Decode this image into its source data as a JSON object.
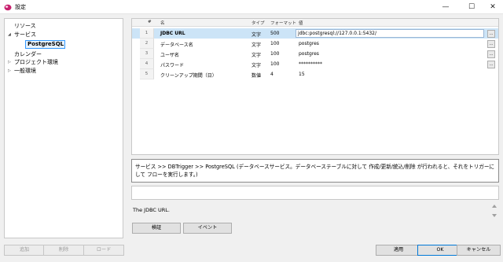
{
  "window": {
    "title": "設定",
    "minimize": "—",
    "maximize": "☐",
    "close": "✕"
  },
  "tree": {
    "items": [
      {
        "label": "リソース"
      },
      {
        "label": "サービス",
        "arrow": "◢"
      },
      {
        "label": "PostgreSQL"
      },
      {
        "label": "カレンダー"
      },
      {
        "label": "プロジェクト環境",
        "arrow": "▷"
      },
      {
        "label": "一般環境",
        "arrow": "▷"
      }
    ]
  },
  "table": {
    "columns": [
      "#",
      "名",
      "タイプ",
      "フォーマット",
      "値"
    ],
    "rows": [
      {
        "num": "1",
        "name": "JDBC URL",
        "type": "文字",
        "format": "500",
        "value": "jdbc:postgresql://127.0.0.1:5432/",
        "has_button": true
      },
      {
        "num": "2",
        "name": "データベース名",
        "type": "文字",
        "format": "100",
        "value": "postgres",
        "has_button": true
      },
      {
        "num": "3",
        "name": "ユーザ名",
        "type": "文字",
        "format": "100",
        "value": "postgres",
        "has_button": true
      },
      {
        "num": "4",
        "name": "パスワード",
        "type": "文字",
        "format": "100",
        "value": "**********",
        "has_button": true
      },
      {
        "num": "5",
        "name": "クリーンアップ期間（日）",
        "type": "数値",
        "format": "4",
        "value": "15",
        "has_button": false
      }
    ],
    "ellipsis": "..."
  },
  "description": "サービス >> DBTrigger >> PostgreSQL (データベースサービス。データベーステーブルに対して 作成/更新/統込/削除 が行われると、それをトリガーにして フローを実行します。)",
  "help_text": "The JDBC URL.",
  "buttons": {
    "verify": "検証",
    "event": "イベント",
    "add": "追加",
    "delete": "削除",
    "load": "ロード",
    "apply": "適用",
    "ok": "OK",
    "cancel": "キャンセル"
  },
  "colors": {
    "selection": "#cce4f7",
    "accent": "#0078d7",
    "app_icon": "#c8206e"
  }
}
